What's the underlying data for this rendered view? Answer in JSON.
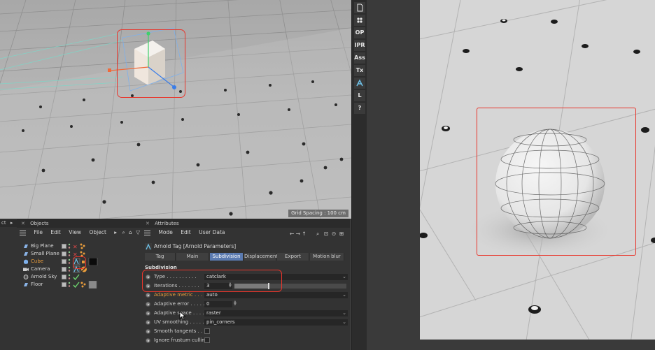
{
  "viewport": {
    "grid_spacing_label": "Grid Spacing : 100 cm"
  },
  "toolbar": {
    "buttons": [
      {
        "label": "",
        "icon": "page-icon"
      },
      {
        "label": "",
        "icon": "dots-icon"
      },
      {
        "label": "OP",
        "icon": "text"
      },
      {
        "label": "IPR",
        "icon": "text"
      },
      {
        "label": "Ass",
        "icon": "text"
      },
      {
        "label": "Tx",
        "icon": "text"
      },
      {
        "label": "",
        "icon": "arnold-logo-icon"
      },
      {
        "label": "L",
        "icon": "text"
      },
      {
        "label": "?",
        "icon": "text"
      }
    ]
  },
  "left_stub": {
    "label": "ct",
    "arrow": "▸"
  },
  "objects_panel": {
    "close": "✕",
    "title": "Objects",
    "menu": [
      "File",
      "Edit",
      "View",
      "Object"
    ],
    "more_arrow": "▸",
    "items": [
      {
        "name": "Big Plane",
        "highlight": false,
        "icon_color": "#8ab4e8"
      },
      {
        "name": "Small Plane",
        "highlight": false,
        "icon_color": "#8ab4e8"
      },
      {
        "name": "Cube",
        "highlight": true,
        "icon_color": "#7fb0ea"
      },
      {
        "name": "Camera",
        "highlight": false,
        "icon_color": "#cfcfcf"
      },
      {
        "name": "Arnold Sky",
        "highlight": false,
        "icon_color": "#cfcfcf"
      },
      {
        "name": "Floor",
        "highlight": false,
        "icon_color": "#8ab4e8"
      }
    ]
  },
  "attributes_panel": {
    "close": "✕",
    "title": "Attributes",
    "menu": [
      "Mode",
      "Edit",
      "User Data"
    ],
    "nav_arrows": "← → ↑",
    "tag_title": "Arnold Tag [Arnold Parameters]",
    "tabs": [
      "Tag",
      "Main",
      "Subdivision",
      "Displacement",
      "Export",
      "Motion blur"
    ],
    "active_tab": "Subdivision",
    "section": "Subdivision",
    "rows": [
      {
        "label": "Type . . . . . . . . . .",
        "value": "catclark",
        "kind": "dropdown"
      },
      {
        "label": "Iterations . . . . . . .",
        "value": "3",
        "kind": "slider",
        "slider_fraction": 0.27
      },
      {
        "label": "Adaptive metric . . . .",
        "value": "auto",
        "kind": "dropdown",
        "orange": true
      },
      {
        "label": "Adaptive error . . . . .",
        "value": "0",
        "kind": "number"
      },
      {
        "label": "Adaptive space . . . .",
        "value": "raster",
        "kind": "dropdown"
      },
      {
        "label": "UV smoothing . . . . .",
        "value": "pin_corners",
        "kind": "dropdown"
      },
      {
        "label": "Smooth tangents . . .",
        "value": "",
        "kind": "checkbox"
      },
      {
        "label": "Ignore frustum culling",
        "value": "",
        "kind": "checkbox"
      }
    ]
  },
  "colors": {
    "highlight_red": "#e8352b",
    "accent_orange": "#e89c3c",
    "tab_active": "#5a7ab0"
  }
}
